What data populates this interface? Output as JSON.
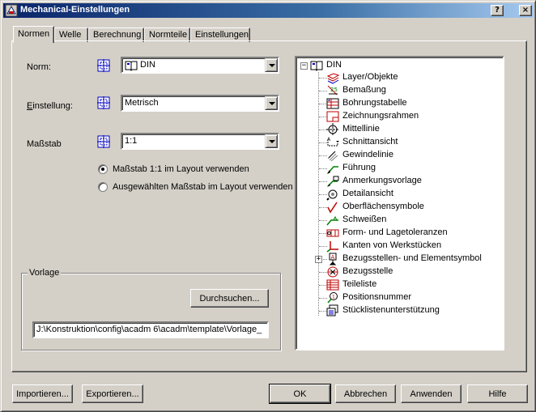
{
  "window": {
    "title": "Mechanical-Einstellungen",
    "controls": {
      "help": "?",
      "close": "×"
    }
  },
  "tabs": [
    {
      "label": "Normen",
      "active": true
    },
    {
      "label": "Welle",
      "active": false
    },
    {
      "label": "Berechnung",
      "active": false
    },
    {
      "label": "Normteile",
      "active": false
    },
    {
      "label": "Einstellungen",
      "active": false
    }
  ],
  "form": {
    "norm": {
      "label": "Norm:",
      "value": "DIN"
    },
    "einstellung": {
      "label": "Einstellung:",
      "value": "Metrisch"
    },
    "massstab": {
      "label": "Maßstab",
      "value": "1:1"
    },
    "radio1": {
      "label": "Maßstab 1:1 im Layout verwenden",
      "checked": true
    },
    "radio2": {
      "label": "Ausgewählten Maßstab im Layout verwenden",
      "checked": false
    }
  },
  "vorlage": {
    "label": "Vorlage",
    "browse": "Durchsuchen...",
    "path": "J:\\Konstruktion\\config\\acadm 6\\acadm\\template\\Vorlage_"
  },
  "tree": {
    "root": "DIN",
    "items": [
      {
        "label": "Layer/Objekte",
        "icon": "layer-icon"
      },
      {
        "label": "Bemaßung",
        "icon": "dimension-icon"
      },
      {
        "label": "Bohrungstabelle",
        "icon": "hole-table-icon"
      },
      {
        "label": "Zeichnungsrahmen",
        "icon": "title-block-icon"
      },
      {
        "label": "Mittellinie",
        "icon": "centerline-icon"
      },
      {
        "label": "Schnittansicht",
        "icon": "section-view-icon"
      },
      {
        "label": "Gewindelinie",
        "icon": "thread-icon"
      },
      {
        "label": "Führung",
        "icon": "leader-icon"
      },
      {
        "label": "Anmerkungsvorlage",
        "icon": "note-template-icon"
      },
      {
        "label": "Detailansicht",
        "icon": "detail-view-icon"
      },
      {
        "label": "Oberflächensymbole",
        "icon": "surface-symbol-icon"
      },
      {
        "label": "Schweißen",
        "icon": "weld-icon"
      },
      {
        "label": "Form- und Lagetoleranzen",
        "icon": "tolerance-icon"
      },
      {
        "label": "Kanten von Werkstücken",
        "icon": "edge-icon"
      },
      {
        "label": "Bezugsstellen- und Elementsymbol",
        "icon": "datum-symbol-icon",
        "expandable": true
      },
      {
        "label": "Bezugsstelle",
        "icon": "datum-target-icon"
      },
      {
        "label": "Teileliste",
        "icon": "parts-list-icon"
      },
      {
        "label": "Positionsnummer",
        "icon": "balloon-icon"
      },
      {
        "label": "Stücklistenunterstützung",
        "icon": "bom-icon"
      }
    ]
  },
  "buttons": {
    "import": "Importieren...",
    "export": "Exportieren...",
    "ok": "OK",
    "cancel": "Abbrechen",
    "apply": "Anwenden",
    "help": "Hilfe"
  },
  "colors": {
    "face": "#d4d0c8",
    "title_start": "#0a246a",
    "title_end": "#a6caf0",
    "accent_blue": "#0000c0",
    "accent_red": "#c00000",
    "accent_green": "#008000"
  }
}
